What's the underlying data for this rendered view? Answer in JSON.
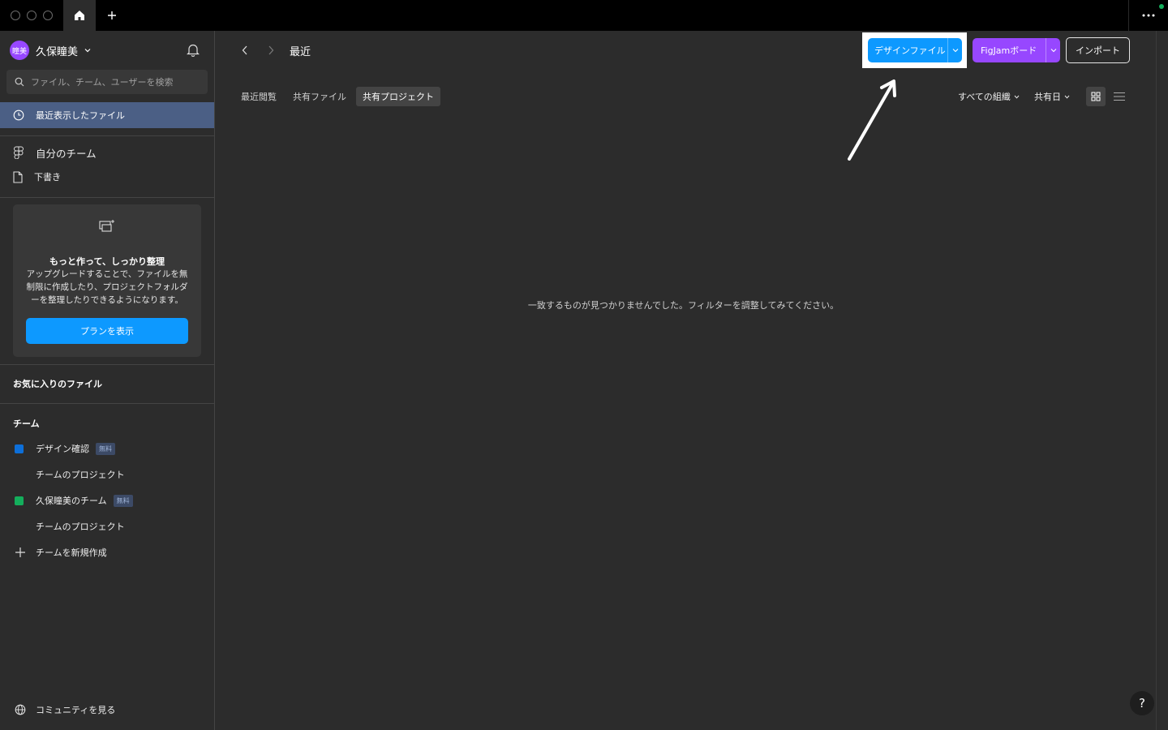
{
  "user": {
    "avatar_text": "瞳美",
    "name": "久保瞳美"
  },
  "search": {
    "placeholder": "ファイル、チーム、ユーザーを検索"
  },
  "sidebar": {
    "recent": "最近表示したファイル",
    "my_team": "自分のチーム",
    "drafts": "下書き",
    "upsell": {
      "title": "もっと作って、しっかり整理",
      "body": "アップグレードすることで、ファイルを無制限に作成したり、プロジェクトフォルダーを整理したりできるようになります。",
      "button": "プランを表示"
    },
    "favorites_title": "お気に入りのファイル",
    "teams_title": "チーム",
    "teams": [
      {
        "name": "デザイン確認",
        "badge": "無料",
        "color": "#0d6fd9",
        "project": "チームのプロジェクト"
      },
      {
        "name": "久保瞳美のチーム",
        "badge": "無料",
        "color": "#14ae5c",
        "project": "チームのプロジェクト"
      }
    ],
    "new_team": "チームを新規作成",
    "community": "コミュニティを見る"
  },
  "header": {
    "title": "最近",
    "design_file": "デザインファイル",
    "figjam_board": "FigJamボード",
    "import": "インポート"
  },
  "tabs": [
    "最近閲覧",
    "共有ファイル",
    "共有プロジェクト"
  ],
  "filters": {
    "org": "すべての組織",
    "sort": "共有日"
  },
  "empty_message": "一致するものが見つかりませんでした。フィルターを調整してみてください。",
  "help": "?",
  "colors": {
    "accent_blue": "#0d99ff",
    "figjam_purple": "#9747ff",
    "active_nav": "#4b5f85"
  }
}
